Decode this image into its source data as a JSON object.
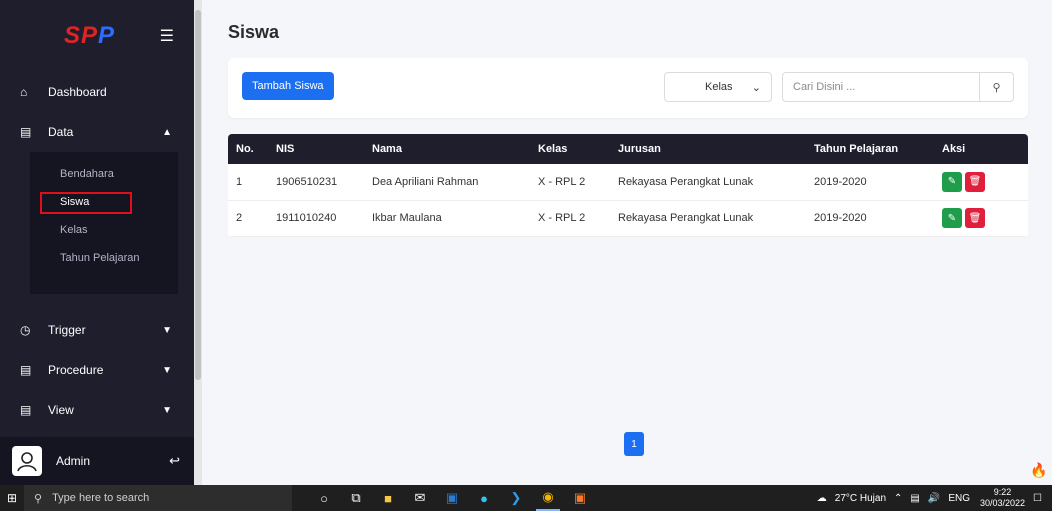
{
  "sidebar": {
    "logo": "SPP",
    "items": [
      {
        "label": "Dashboard",
        "icon": "home-icon"
      },
      {
        "label": "Data",
        "icon": "database-icon"
      },
      {
        "label": "Trigger",
        "icon": "clock-icon"
      },
      {
        "label": "Procedure",
        "icon": "database-icon"
      },
      {
        "label": "View",
        "icon": "database-icon"
      }
    ],
    "submenu": [
      "Bendahara",
      "Siswa",
      "Kelas",
      "Tahun Pelajaran"
    ],
    "active_sub": "Siswa",
    "user": "Admin"
  },
  "page": {
    "title": "Siswa",
    "add_button": "Tambah Siswa",
    "kelas_select": "Kelas",
    "search_placeholder": "Cari Disini ..."
  },
  "table": {
    "headers": [
      "No.",
      "NIS",
      "Nama",
      "Kelas",
      "Jurusan",
      "Tahun Pelajaran",
      "Aksi"
    ],
    "rows": [
      [
        "1",
        "1906510231",
        "Dea Apriliani Rahman",
        "X - RPL 2",
        "Rekayasa Perangkat Lunak",
        "2019-2020"
      ],
      [
        "2",
        "1911010240",
        "Ikbar Maulana",
        "X - RPL 2",
        "Rekayasa Perangkat Lunak",
        "2019-2020"
      ]
    ]
  },
  "pagination": {
    "current": "1"
  },
  "taskbar": {
    "search_placeholder": "Type here to search",
    "weather": "27°C Hujan",
    "lang": "ENG",
    "time": "9:22",
    "date": "30/03/2022"
  },
  "colors": {
    "sidebar_bg": "#1e1e2d",
    "primary": "#1d6ff2",
    "edit": "#1f9d4a",
    "delete": "#e01f3d",
    "highlight": "#e0101a"
  }
}
